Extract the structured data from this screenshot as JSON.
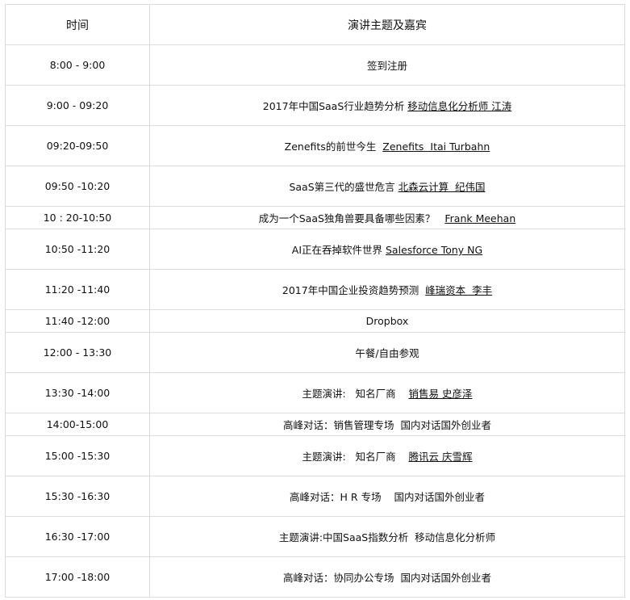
{
  "header": {
    "time": "时间",
    "topic": "演讲主题及嘉宾"
  },
  "rows": [
    {
      "time": "8:00 - 9:00",
      "parts": [
        {
          "t": "签到注册"
        }
      ]
    },
    {
      "time": "9:00 - 09:20",
      "parts": [
        {
          "t": "2017年中国SaaS行业趋势分析 "
        },
        {
          "t": "移动信息化分析师 江涛",
          "u": true
        }
      ]
    },
    {
      "time": "09:20-09:50",
      "parts": [
        {
          "t": "Zenefits的前世今生  "
        },
        {
          "t": "Zenefits  Itai Turbahn",
          "u": true
        }
      ]
    },
    {
      "time": "09:50 -10:20",
      "parts": [
        {
          "t": "SaaS第三代的盛世危言 "
        },
        {
          "t": "北森云计算  纪伟国",
          "u": true
        }
      ]
    },
    {
      "time": "10 : 20-10:50",
      "parts": [
        {
          "t": "成为一个SaaS独角兽要具备哪些因素？   "
        },
        {
          "t": "Frank Meehan",
          "u": true
        }
      ]
    },
    {
      "time": "10:50 -11:20",
      "parts": [
        {
          "t": "AI正在吞掉软件世界 "
        },
        {
          "t": "Salesforce Tony NG",
          "u": true
        }
      ]
    },
    {
      "time": "11:20 -11:40",
      "parts": [
        {
          "t": "2017年中国企业投资趋势预测  "
        },
        {
          "t": "峰瑞资本  李丰",
          "u": true
        }
      ]
    },
    {
      "time": "11:40 -12:00",
      "parts": [
        {
          "t": "Dropbox"
        }
      ]
    },
    {
      "time": "12:00 - 13:30",
      "parts": [
        {
          "t": "午餐/自由参观"
        }
      ]
    },
    {
      "time": "13:30 -14:00",
      "parts": [
        {
          "t": "主题演讲:   知名厂商    "
        },
        {
          "t": "销售易 史彦泽",
          "u": true
        }
      ]
    },
    {
      "time": "14:00-15:00",
      "parts": [
        {
          "t": "高峰对话：销售管理专场  国内对话国外创业者"
        }
      ]
    },
    {
      "time": "15:00 -15:30",
      "parts": [
        {
          "t": "主题演讲:   知名厂商    "
        },
        {
          "t": "腾讯云 庆雪辉",
          "u": true
        }
      ]
    },
    {
      "time": "15:30 -16:30",
      "parts": [
        {
          "t": "高峰对话：H R 专场    国内对话国外创业者"
        }
      ]
    },
    {
      "time": "16:30 -17:00",
      "parts": [
        {
          "t": "主题演讲:中国SaaS指数分析  移动信息化分析师"
        }
      ]
    },
    {
      "time": "17:00 -18:00",
      "parts": [
        {
          "t": "高峰对话：协同办公专场  国内对话国外创业者"
        }
      ]
    }
  ]
}
